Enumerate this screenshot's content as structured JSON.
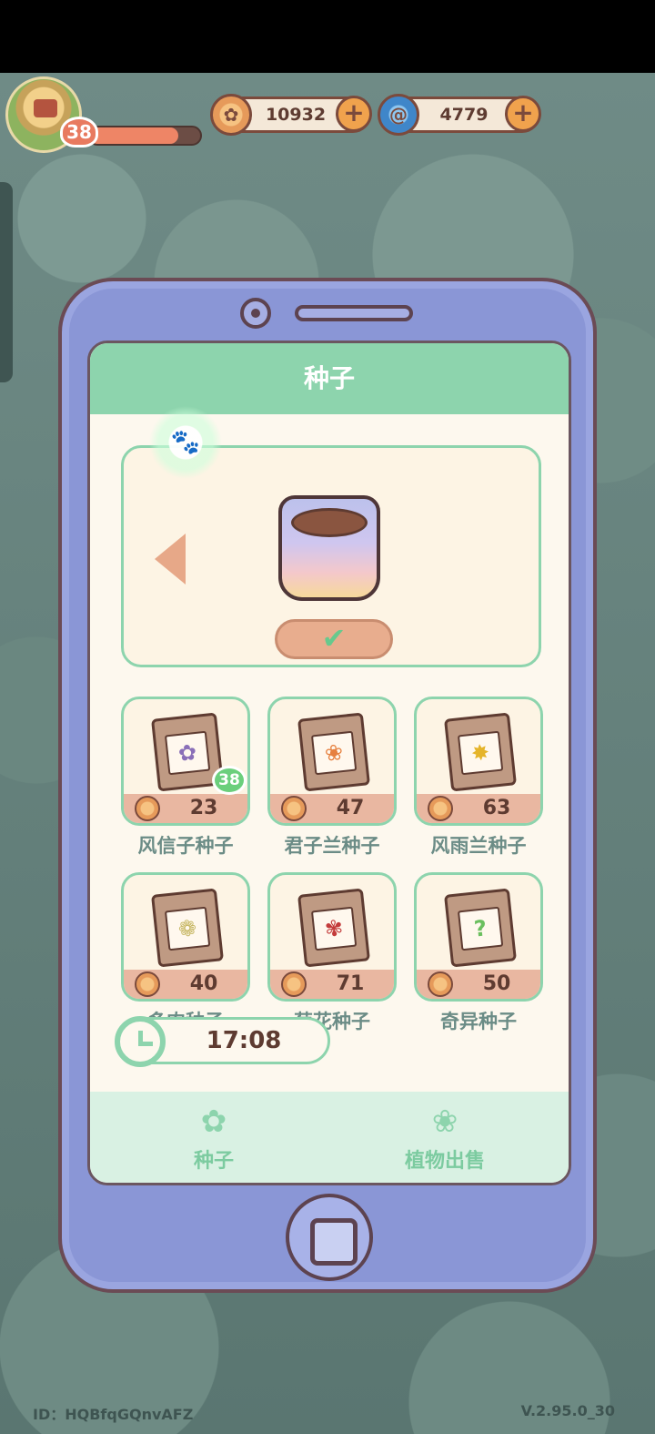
{
  "hud": {
    "level": "38",
    "xp_progress": 0.8,
    "coins": "10932",
    "gems": "4779",
    "plus": "+"
  },
  "screen": {
    "title": "种子",
    "confirm_icon": "✔",
    "paw_icon": "🐾"
  },
  "seeds": [
    {
      "name": "风信子种子",
      "price": "23",
      "stock": "38",
      "icon": "hyacinth-packet-icon",
      "glyph": "✿",
      "color": "#8a6fb8"
    },
    {
      "name": "君子兰种子",
      "price": "47",
      "icon": "clivia-packet-icon",
      "glyph": "❀",
      "color": "#e6803f"
    },
    {
      "name": "风雨兰种子",
      "price": "63",
      "icon": "zephyranthes-packet-icon",
      "glyph": "✸",
      "color": "#e5b42a"
    },
    {
      "name": "多肉种子",
      "price": "40",
      "icon": "succulent-packet-icon",
      "glyph": "❁",
      "color": "#c7b764"
    },
    {
      "name": "菊花种子",
      "price": "71",
      "icon": "chrysanthemum-packet-icon",
      "glyph": "✾",
      "color": "#c33b3b"
    },
    {
      "name": "奇异种子",
      "price": "50",
      "icon": "mystery-packet-icon",
      "glyph": "?",
      "color": "#6bbf5f"
    }
  ],
  "timer": "17:08",
  "nav": {
    "seed_label": "种子",
    "sale_label": "植物出售",
    "seed_icon": "✿",
    "sale_icon": "❀"
  },
  "footer": {
    "id": "ID：HQBfqGQnvAFZ",
    "version": "V.2.95.0_30"
  }
}
